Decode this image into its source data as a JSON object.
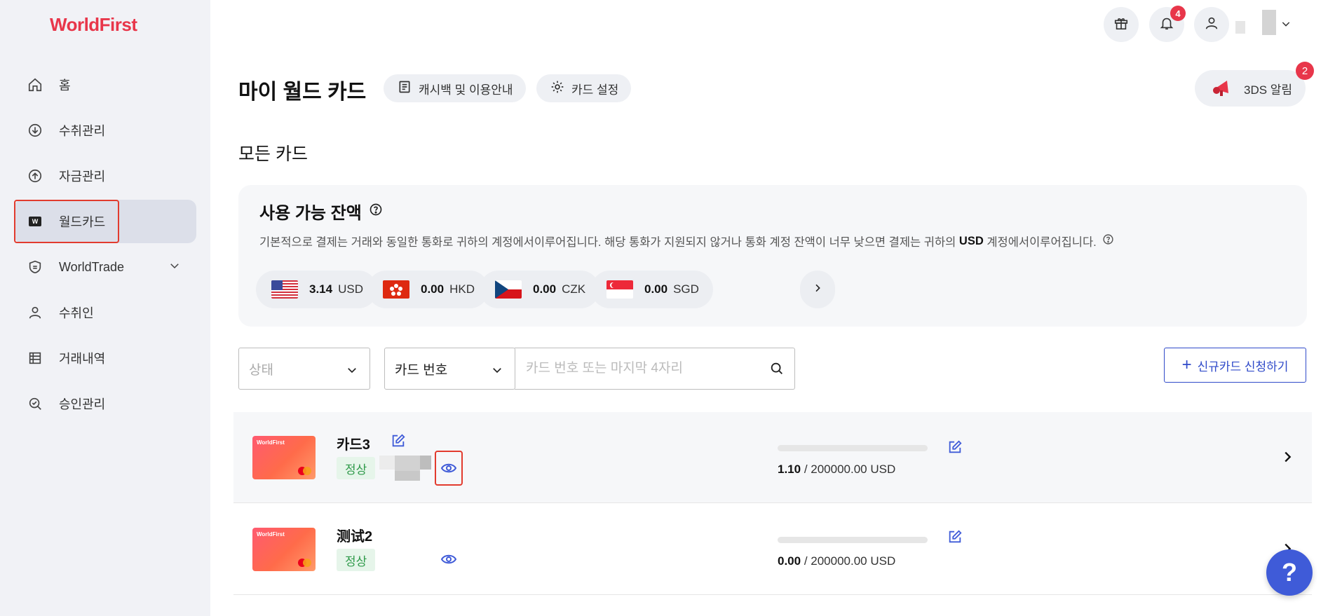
{
  "brand": {
    "logo": "WorldFirst"
  },
  "sidebar": {
    "items": [
      {
        "label": "홈",
        "icon": "home-icon"
      },
      {
        "label": "수취관리",
        "icon": "receive-icon"
      },
      {
        "label": "자금관리",
        "icon": "send-icon"
      },
      {
        "label": "월드카드",
        "icon": "world-card-icon",
        "active": true
      },
      {
        "label": "WorldTrade",
        "icon": "shield-icon"
      },
      {
        "label": "수취인",
        "icon": "person-icon"
      },
      {
        "label": "거래내역",
        "icon": "list-icon"
      },
      {
        "label": "승인관리",
        "icon": "approval-icon"
      }
    ]
  },
  "topbar": {
    "notification_count": "4"
  },
  "header": {
    "title": "마이 월드 카드",
    "cashback_label": "캐시백 및 이용안내",
    "settings_label": "카드 설정",
    "alert_label": "3DS 알림",
    "alert_count": "2"
  },
  "section": {
    "title": "모든 카드"
  },
  "balance": {
    "title": "사용 가능 잔액",
    "desc_before": "기본적으로 결제는 거래와 동일한 통화로 귀하의 계정에서이루어집니다. 해당 통화가 지원되지 않거나 통화 계정 잔액이 너무 낮으면 결제는 귀하의",
    "desc_bold": "USD",
    "desc_after": "계정에서이루어집니다.",
    "currencies": [
      {
        "amount": "3.14",
        "code": "USD"
      },
      {
        "amount": "0.00",
        "code": "HKD"
      },
      {
        "amount": "0.00",
        "code": "CZK"
      },
      {
        "amount": "0.00",
        "code": "SGD"
      }
    ]
  },
  "filters": {
    "status_placeholder": "상태",
    "type_value": "카드 번호",
    "search_placeholder": "카드 번호 또는 마지막 4자리",
    "new_card_label": "신규카드 신청하기"
  },
  "cards": [
    {
      "name": "카드3",
      "status": "정상",
      "brand": "WorldFirst",
      "used": "1.10",
      "limit": " / 200000.00 USD",
      "usage_fraction": 0.0
    },
    {
      "name": "测试2",
      "status": "정상",
      "brand": "WorldFirst",
      "used": "0.00",
      "limit": " / 200000.00 USD",
      "usage_fraction": 0.0
    }
  ],
  "help": {
    "label": "?"
  },
  "colors": {
    "brand": "#e8364a",
    "accent": "#2f4ac9",
    "status_green": "#2f9a4a",
    "highlight": "#e23b2e"
  }
}
